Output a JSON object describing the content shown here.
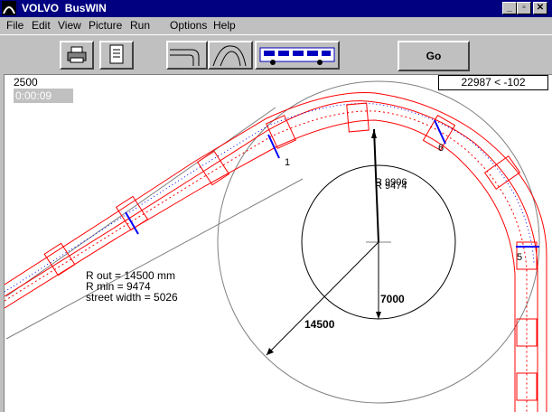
{
  "window": {
    "title": "VOLVO  BusWIN",
    "min": "_",
    "max": "▫",
    "close": "✕"
  },
  "menu": [
    "File",
    "Edit",
    "View",
    "Picture",
    "Run",
    "Options",
    "Help"
  ],
  "toolbar": {
    "go_label": "Go"
  },
  "status": {
    "value": "2500",
    "timer": "0:00:09",
    "coords": "22987 < -102"
  },
  "params": {
    "r_out": "R out =   14500 mm",
    "r_min": "R min = 9474",
    "street_width": "street width  = 5026"
  },
  "annotations": {
    "dim_14500": "14500",
    "dim_7000": "7000",
    "r_9906": "R 9906",
    "r_9474": "R 9474",
    "marker_1": "1",
    "marker_5": "5",
    "marker_6": "6"
  },
  "colors": {
    "bus": "#ff0000",
    "axle": "#0000ff",
    "construction": "#808080"
  }
}
